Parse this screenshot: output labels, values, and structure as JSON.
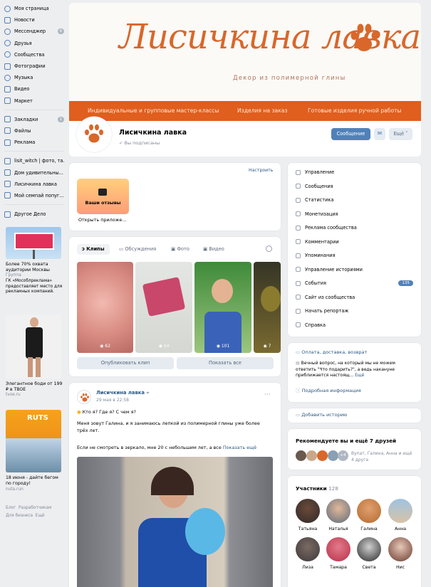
{
  "sidebar": {
    "items": [
      {
        "label": "Моя страница",
        "icon": "user-icon"
      },
      {
        "label": "Новости",
        "icon": "news-icon"
      },
      {
        "label": "Мессенджер",
        "icon": "message-icon",
        "count": "9"
      },
      {
        "label": "Друзья",
        "icon": "friends-icon"
      },
      {
        "label": "Сообщества",
        "icon": "groups-icon"
      },
      {
        "label": "Фотографии",
        "icon": "photo-icon"
      },
      {
        "label": "Музыка",
        "icon": "music-icon"
      },
      {
        "label": "Видео",
        "icon": "video-icon"
      },
      {
        "label": "Маркет",
        "icon": "market-icon"
      }
    ],
    "items2": [
      {
        "label": "Закладки",
        "icon": "bookmark-icon",
        "count": "1"
      },
      {
        "label": "Файлы",
        "icon": "file-icon"
      },
      {
        "label": "Реклама",
        "icon": "ads-icon"
      }
    ],
    "items3": [
      {
        "label": "lisit_witch | фото, та..."
      },
      {
        "label": "Дом удивительны..."
      },
      {
        "label": "Лисичкина лавка"
      },
      {
        "label": "Мой семпай попуг..."
      }
    ],
    "items4": [
      {
        "label": "Другое Дело"
      }
    ],
    "ads": [
      {
        "title": "Более 70% охвата аудитории Москвы",
        "sub1": "Группа",
        "text": "ГК «Мособлреклама» предоставляет место для рекламных компаний."
      },
      {
        "title": "Элегантное боди от 199 ₽ в TBOE",
        "sub1": "tvoe.ru"
      },
      {
        "title": "18 июня - дайте бегом по городу!",
        "sub1": "nuta.run",
        "banner": "RUTS"
      }
    ],
    "footer": [
      "Блог",
      "Разработчикам",
      "Для бизнеса",
      "Ещё"
    ]
  },
  "cover": {
    "logo_text": "Лисичкина лавка",
    "subtitle": "Декор из полимерной глины",
    "menu": [
      "Индивидуальные и групповые мастер-классы",
      "Изделия на заказ",
      "Готовые изделия ручной работы"
    ]
  },
  "header": {
    "name": "Лисичкина лавка",
    "status": "Вы подписаны",
    "message_button": "Сообщение",
    "more_button": "Ещё"
  },
  "widgets": {
    "settings_link": "Настроить",
    "review_label": "Ваши отзывы",
    "app_label": "Открыть приложе..."
  },
  "media": {
    "tabs": [
      "Клипы",
      "Обсуждения",
      "Фото",
      "Видео"
    ],
    "clips": [
      {
        "views": "62"
      },
      {
        "views": "54"
      },
      {
        "views": "101"
      },
      {
        "views": "7"
      }
    ],
    "publish_button": "Опубликовать клип",
    "show_all_button": "Показать все"
  },
  "post": {
    "author": "Лисичкина лавка",
    "date": "29 мая в 22:58",
    "line1": "Кто я? Где я? С чем я?",
    "line2": "Меня зовут Галина, и я занимаюсь лепкой из полимерной глины уже более трёх лет.",
    "line3": "Если не смотреть в зеркало, мне 20 с небольшим лет, а все",
    "more_link": "Показать ещё"
  },
  "right_menu": {
    "items": [
      {
        "label": "Управление",
        "icon": "settings-icon"
      },
      {
        "label": "Сообщения",
        "icon": "message-icon"
      },
      {
        "label": "Статистика",
        "icon": "stats-icon"
      },
      {
        "label": "Монетизация",
        "icon": "money-icon"
      },
      {
        "label": "Реклама сообщества",
        "icon": "ads-icon"
      },
      {
        "label": "Комментарии",
        "icon": "comment-icon"
      },
      {
        "label": "Упоминания",
        "icon": "mention-icon"
      },
      {
        "label": "Управление историями",
        "icon": "story-icon"
      },
      {
        "label": "События",
        "icon": "event-icon",
        "count": "135"
      },
      {
        "label": "Сайт из сообщества",
        "icon": "site-icon"
      },
      {
        "label": "Начать репортаж",
        "icon": "live-icon"
      },
      {
        "label": "Справка",
        "icon": "help-icon"
      }
    ]
  },
  "info": {
    "title": "Оплата, доставка, возврат",
    "text": "Вечный вопрос, на который мы не можем ответить \"Что подарить?\", а ведь накануне приближается настоящ...",
    "more": "Ещё",
    "details_link": "Подробная информация"
  },
  "story": {
    "label": "Добавить историю"
  },
  "recommend": {
    "title": "Рекомендуете вы и ещё 7 друзей",
    "names": "Вупат, Галина, Анна и ещё",
    "count": "4 друга",
    "plus": "+4"
  },
  "members": {
    "title": "Участники",
    "count": "128",
    "people": [
      "Татьяна",
      "Наталья",
      "Галина",
      "Анна",
      "Лиза",
      "Тамара",
      "Света",
      "Нис"
    ]
  },
  "colors": {
    "accent": "#e05e1e",
    "vk_blue": "#5181b8",
    "link": "#2a5885"
  }
}
